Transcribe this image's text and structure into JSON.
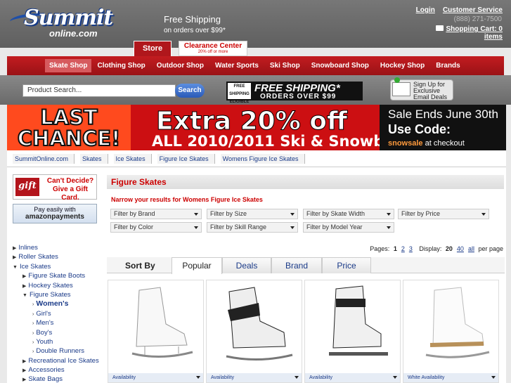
{
  "header": {
    "logo_main": "Summit",
    "logo_sub": "online.com",
    "free_shipping": "Free Shipping",
    "free_shipping_sub": "on orders over $99*",
    "login": "Login",
    "customer_service": "Customer Service",
    "phone": "(888) 271-7500",
    "cart": "Shopping Cart: 0 items"
  },
  "tabs": {
    "store": "Store",
    "clearance": "Clearance Center",
    "clearance_sub": "20% off or more"
  },
  "nav": [
    "Skate Shop",
    "Clothing Shop",
    "Outdoor Shop",
    "Water Sports",
    "Ski Shop",
    "Snowboard Shop",
    "Hockey Shop",
    "Brands"
  ],
  "search": {
    "placeholder": "Product Search...",
    "button": "Search"
  },
  "promo": {
    "badge_small": "FREE SHIPPING ELIGIBLE",
    "badge_main": "FREE SHIPPING*",
    "badge_sub": "ORDERS OVER $99",
    "signup": "Sign Up for Exclusive Email Deals"
  },
  "banner": {
    "left": "LAST CHANCE!",
    "headline": "Extra 20% off",
    "subline": "ALL 2010/2011 Ski & Snowboard Gear",
    "sale_ends": "Sale Ends June 30th",
    "use_code": "Use Code:",
    "code": "snowsale",
    "code_suffix": "at checkout"
  },
  "breadcrumb": [
    "SummitOnline.com",
    "Skates",
    "Ice Skates",
    "Figure Ice Skates",
    "Womens Figure Ice Skates"
  ],
  "sidebar": {
    "gift_logo": "gift",
    "gift_text": "Can't Decide? Give a Gift Card.",
    "amazon_top": "Pay easily with",
    "amazon_main": "amazonpayments",
    "tree": [
      {
        "label": "Inlines",
        "level": 0
      },
      {
        "label": "Roller Skates",
        "level": 0
      },
      {
        "label": "Ice Skates",
        "level": 0
      },
      {
        "label": "Figure Skate Boots",
        "level": 1
      },
      {
        "label": "Hockey Skates",
        "level": 1
      },
      {
        "label": "Figure Skates",
        "level": 1
      },
      {
        "label": "Women's",
        "level": 2,
        "bold": true
      },
      {
        "label": "Girl's",
        "level": 2
      },
      {
        "label": "Men's",
        "level": 2
      },
      {
        "label": "Boy's",
        "level": 2
      },
      {
        "label": "Youth",
        "level": 2
      },
      {
        "label": "Double Runners",
        "level": 2
      },
      {
        "label": "Recreational Ice Skates",
        "level": 1
      },
      {
        "label": "Accessories",
        "level": 1
      },
      {
        "label": "Skate Bags",
        "level": 1
      }
    ]
  },
  "main": {
    "title": "Figure Skates",
    "narrow": "Narrow your results for Womens Figure Ice Skates",
    "filters": [
      "Filter by Brand",
      "Filter by Size",
      "Filter by Skate Width",
      "Filter by Price",
      "Filter by Color",
      "Filter by Skill Range",
      "Filter by Model Year"
    ],
    "pages_label": "Pages:",
    "pages": [
      "1",
      "2",
      "3"
    ],
    "display_label": "Display:",
    "display": [
      "20",
      "40",
      "all"
    ],
    "per_page": "per page",
    "sort_label": "Sort By",
    "sort_tabs": [
      "Popular",
      "Deals",
      "Brand",
      "Price"
    ],
    "products": [
      {
        "availability": "Availability"
      },
      {
        "availability": "Availability"
      },
      {
        "availability": "Availability"
      },
      {
        "availability": "White Availability"
      }
    ]
  }
}
